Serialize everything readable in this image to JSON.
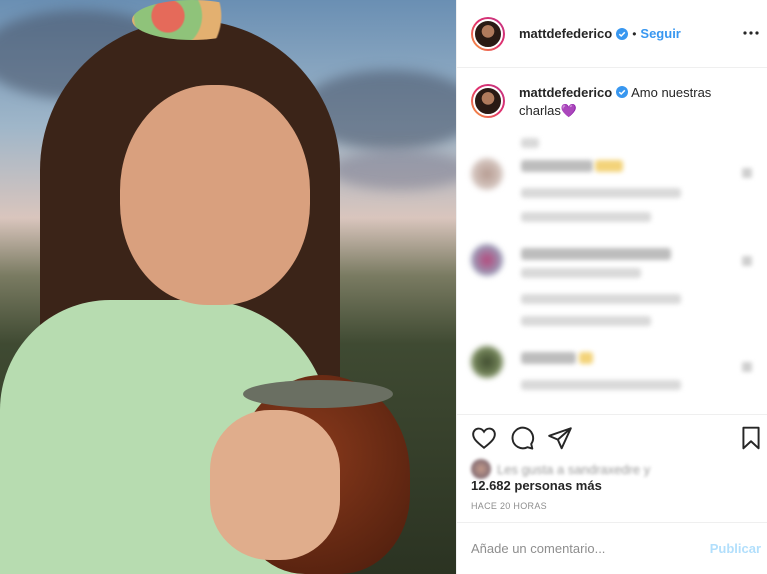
{
  "post": {
    "photo_alt": "",
    "author": {
      "username": "mattdefederico",
      "verified": true
    },
    "header": {
      "follow_label": "Seguir",
      "separator": "•",
      "more_icon": "more-horizontal-icon"
    },
    "caption": {
      "username": "mattdefederico",
      "text": "Amo nuestras charlas",
      "emoji": "💜"
    },
    "comments_blurred": true,
    "actions": {
      "like_icon": "heart-icon",
      "comment_icon": "comment-icon",
      "share_icon": "share-icon",
      "save_icon": "bookmark-icon"
    },
    "likes": {
      "blurred_prefix": "Les gusta a sandraxedre y",
      "count_text": "12.682 personas más"
    },
    "timestamp": "HACE 20 HORAS",
    "add_comment": {
      "placeholder": "Añade un comentario...",
      "publish_label": "Publicar"
    },
    "colors": {
      "link_blue": "#3897f0",
      "publish_disabled": "#b2dffc",
      "verified_blue": "#3897f0",
      "muted_text": "#8e8e8e"
    }
  }
}
